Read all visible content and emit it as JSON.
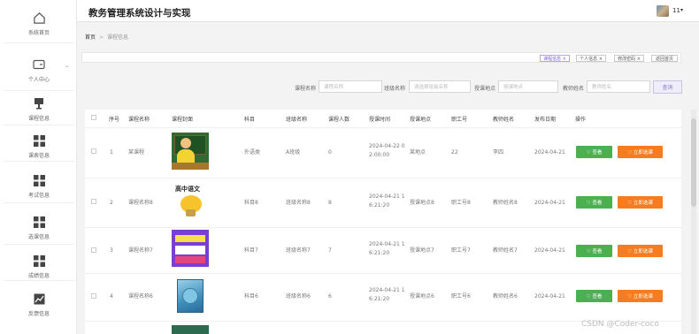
{
  "app": {
    "title": "教务管理系统设计与实现",
    "user": "11"
  },
  "sidebar": {
    "items": [
      {
        "label": "系统首页",
        "icon": "home-icon"
      },
      {
        "label": "个人中心",
        "icon": "wallet-icon",
        "has_arrow": true
      },
      {
        "label": "课程信息",
        "icon": "desk-icon"
      },
      {
        "label": "课表信息",
        "icon": "grid-icon"
      },
      {
        "label": "考试信息",
        "icon": "grid-icon"
      },
      {
        "label": "选课信息",
        "icon": "grid-icon"
      },
      {
        "label": "成绩信息",
        "icon": "grid-icon"
      },
      {
        "label": "反馈信息",
        "icon": "trend-icon"
      }
    ]
  },
  "breadcrumb": {
    "home": "首页",
    "separator": ">",
    "current": "课程信息"
  },
  "tags": [
    {
      "label": "课程信息 ×",
      "active": true
    },
    {
      "label": "个人信息 ×",
      "active": false
    },
    {
      "label": "修改密码 ×",
      "active": false
    },
    {
      "label": "返回首页",
      "active": false
    }
  ],
  "search": {
    "fields": [
      {
        "label": "课程名称",
        "placeholder": "课程名称"
      },
      {
        "label": "班级名称",
        "placeholder": "请选择班级名称"
      },
      {
        "label": "授课地点",
        "placeholder": "授课地点"
      },
      {
        "label": "教师姓名",
        "placeholder": "教师姓名"
      }
    ],
    "button": "查询"
  },
  "table": {
    "headers": [
      "序号",
      "课程名称",
      "课程封面",
      "科目",
      "班级名称",
      "课程人数",
      "授课时间",
      "授课地点",
      "职工号",
      "教师姓名",
      "发布日期",
      "操作"
    ],
    "view_label": "♡ 查看",
    "enroll_label": "♡ 立即选课",
    "rows": [
      {
        "index": "1",
        "course": "某课程",
        "cover": "teacher-cartoon",
        "subject": "外语类",
        "class": "A班级",
        "count": "0",
        "time_line1": "2024-04-22 0",
        "time_line2": "2:00:00",
        "location": "某地点",
        "staff_id": "22",
        "teacher": "李四",
        "date": "2024-04-21"
      },
      {
        "index": "2",
        "course": "课程名称8",
        "cover": "chinese-book",
        "cover_title": "高中语文",
        "subject": "科目8",
        "class": "班级名称8",
        "count": "8",
        "time_line1": "2024-04-21 1",
        "time_line2": "6:21:20",
        "location": "授课地点8",
        "staff_id": "职工号8",
        "teacher": "教师姓名8",
        "date": "2024-04-21"
      },
      {
        "index": "3",
        "course": "课程名称7",
        "cover": "purple-book",
        "subject": "科目7",
        "class": "班级名称7",
        "count": "7",
        "time_line1": "2024-04-21 1",
        "time_line2": "6:21:20",
        "location": "授课地点7",
        "staff_id": "职工号7",
        "teacher": "教师姓名7",
        "date": "2024-04-21"
      },
      {
        "index": "4",
        "course": "课程名称6",
        "cover": "blue-book",
        "subject": "科目6",
        "class": "班级名称6",
        "count": "6",
        "time_line1": "2024-04-21 1",
        "time_line2": "6:21:20",
        "location": "授课地点6",
        "staff_id": "职工号6",
        "teacher": "教师姓名6",
        "date": "2024-04-21"
      }
    ]
  },
  "watermark": "CSDN @Coder-coco",
  "colors": {
    "view": "#4caf50",
    "enroll": "#f57c20",
    "accent": "#7a5fd0"
  }
}
